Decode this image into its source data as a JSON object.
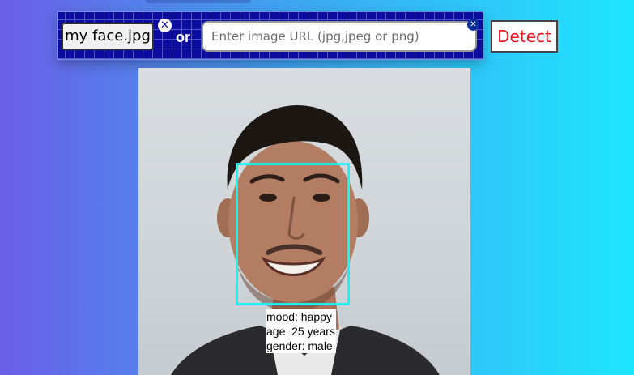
{
  "upload": {
    "file_name": "my face.jpg",
    "clear_icon": "close-circle-icon",
    "separator": "or"
  },
  "url_input": {
    "value": "",
    "placeholder": "Enter image URL (jpg,jpeg or png)",
    "clear_icon": "close-circle-icon"
  },
  "detect_label": "Detect",
  "detection": {
    "box_color": "#1ff0f0",
    "mood": "mood: happy",
    "age": "age: 25 years",
    "gender": "gender: male"
  },
  "colors": {
    "toolbar_bg": "#0b0ba0",
    "detect_text": "#e8141e",
    "background_left": "#6a5ee6",
    "background_right": "#1ee6fd"
  }
}
